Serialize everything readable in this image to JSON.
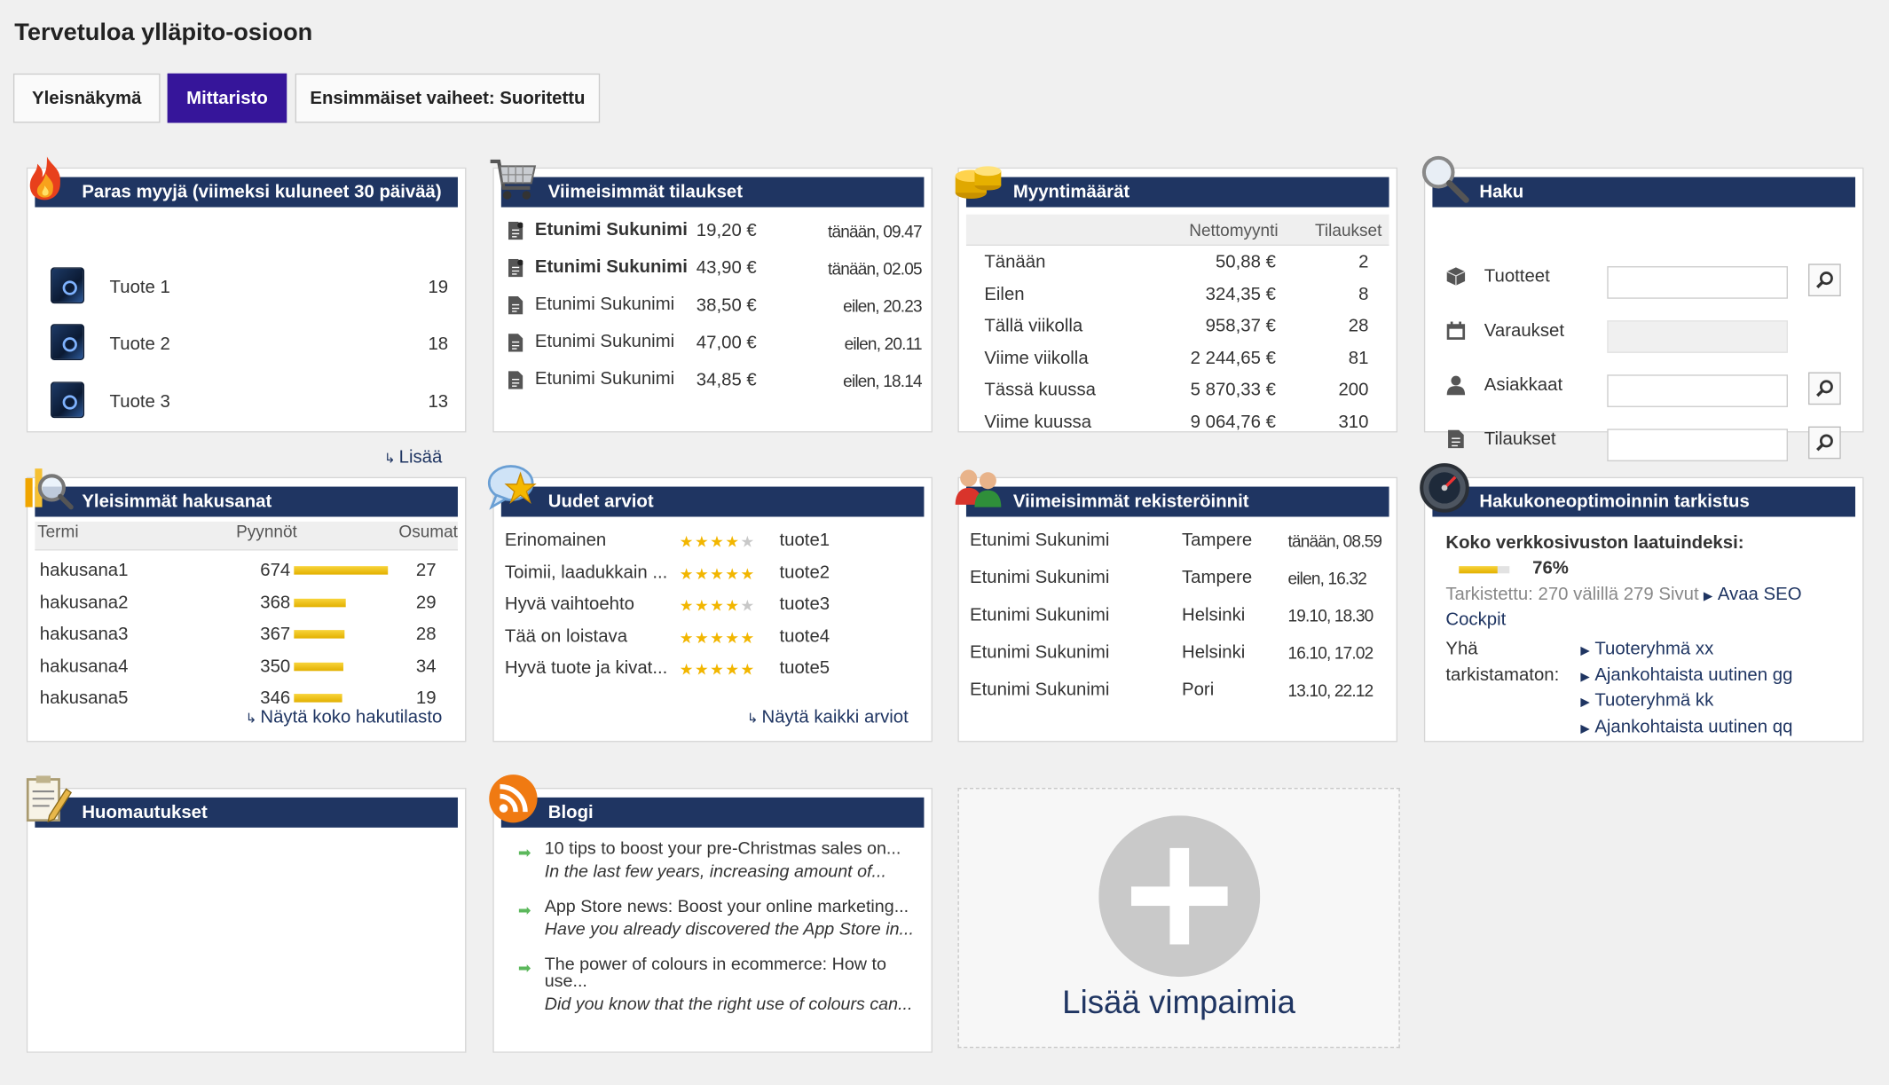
{
  "page": {
    "title": "Tervetuloa ylläpito-osioon"
  },
  "tabs": [
    {
      "label": "Yleisnäkymä"
    },
    {
      "label": "Mittaristo"
    },
    {
      "label": "Ensimmäiset vaiheet: Suoritettu"
    }
  ],
  "best_seller": {
    "title": "Paras myyjä (viimeksi kuluneet 30 päivää)",
    "items": [
      {
        "name": "Tuote 1",
        "count": "19"
      },
      {
        "name": "Tuote 2",
        "count": "18"
      },
      {
        "name": "Tuote 3",
        "count": "13"
      }
    ],
    "more_link": "Lisää"
  },
  "recent_orders": {
    "title": "Viimeisimmät tilaukset",
    "rows": [
      {
        "name": "Etunimi Sukunimi",
        "amount": "19,20 €",
        "time": "tänään, 09.47",
        "bold": true
      },
      {
        "name": "Etunimi Sukunimi",
        "amount": "43,90 €",
        "time": "tänään, 02.05",
        "bold": true
      },
      {
        "name": "Etunimi Sukunimi",
        "amount": "38,50 €",
        "time": "eilen, 20.23",
        "bold": false
      },
      {
        "name": "Etunimi Sukunimi",
        "amount": "47,00 €",
        "time": "eilen, 20.11",
        "bold": false
      },
      {
        "name": "Etunimi Sukunimi",
        "amount": "34,85 €",
        "time": "eilen, 18.14",
        "bold": false
      }
    ]
  },
  "sales": {
    "title": "Myyntimäärät",
    "col_net": "Nettomyynti",
    "col_orders": "Tilaukset",
    "rows": [
      {
        "period": "Tänään",
        "net": "50,88 €",
        "orders": "2"
      },
      {
        "period": "Eilen",
        "net": "324,35 €",
        "orders": "8"
      },
      {
        "period": "Tällä viikolla",
        "net": "958,37 €",
        "orders": "28"
      },
      {
        "period": "Viime viikolla",
        "net": "2 244,65 €",
        "orders": "81"
      },
      {
        "period": "Tässä kuussa",
        "net": "5 870,33 €",
        "orders": "200"
      },
      {
        "period": "Viime kuussa",
        "net": "9 064,76 €",
        "orders": "310"
      }
    ]
  },
  "search": {
    "title": "Haku",
    "rows": [
      {
        "label": "Tuotteet",
        "icon": "box-icon",
        "enabled": true
      },
      {
        "label": "Varaukset",
        "icon": "calendar-icon",
        "enabled": false
      },
      {
        "label": "Asiakkaat",
        "icon": "person-icon",
        "enabled": true
      },
      {
        "label": "Tilaukset",
        "icon": "document-icon",
        "enabled": true
      }
    ]
  },
  "keywords": {
    "title": "Yleisimmät hakusanat",
    "col_term": "Termi",
    "col_requests": "Pyynnöt",
    "col_hits": "Osumat",
    "rows": [
      {
        "term": "hakusana1",
        "requests": 674,
        "hits": "27"
      },
      {
        "term": "hakusana2",
        "requests": 368,
        "hits": "29"
      },
      {
        "term": "hakusana3",
        "requests": 367,
        "hits": "28"
      },
      {
        "term": "hakusana4",
        "requests": 350,
        "hits": "34"
      },
      {
        "term": "hakusana5",
        "requests": 346,
        "hits": "19"
      }
    ],
    "link": "Näytä koko hakutilasto"
  },
  "reviews": {
    "title": "Uudet arviot",
    "rows": [
      {
        "text": "Erinomainen",
        "stars": 4,
        "product": "tuote1"
      },
      {
        "text": "Toimii, laadukkain ...",
        "stars": 5,
        "product": "tuote2"
      },
      {
        "text": "Hyvä vaihtoehto",
        "stars": 4,
        "product": "tuote3"
      },
      {
        "text": "Tää on loistava",
        "stars": 5,
        "product": "tuote4"
      },
      {
        "text": "Hyvä tuote ja kivat...",
        "stars": 5,
        "product": "tuote5"
      }
    ],
    "link": "Näytä kaikki arviot"
  },
  "registrations": {
    "title": "Viimeisimmät rekisteröinnit",
    "rows": [
      {
        "name": "Etunimi Sukunimi",
        "city": "Tampere",
        "time": "tänään, 08.59"
      },
      {
        "name": "Etunimi Sukunimi",
        "city": "Tampere",
        "time": "eilen, 16.32"
      },
      {
        "name": "Etunimi Sukunimi",
        "city": "Helsinki",
        "time": "19.10, 18.30"
      },
      {
        "name": "Etunimi Sukunimi",
        "city": "Helsinki",
        "time": "16.10, 17.02"
      },
      {
        "name": "Etunimi Sukunimi",
        "city": "Pori",
        "time": "13.10, 22.12"
      }
    ]
  },
  "seo": {
    "title": "Hakukoneoptimoinnin tarkistus",
    "quality_label": "Koko verkkosivuston laatuindeksi:",
    "quality_value": "76%",
    "quality_fraction": 0.76,
    "checked_text": "Tarkistettu: 270 välillä 279 Sivut",
    "cockpit_link_line1": "Avaa SEO",
    "cockpit_link_line2": "Cockpit",
    "unchecked_label_line1": "Yhä",
    "unchecked_label_line2": "tarkistamaton:",
    "unchecked_items": [
      "Tuoteryhmä xx",
      "Ajankohtaista uutinen gg",
      "Tuoteryhmä kk",
      "Ajankohtaista uutinen qq"
    ]
  },
  "notes": {
    "title": "Huomautukset"
  },
  "blog": {
    "title": "Blogi",
    "posts": [
      {
        "title": "10 tips to boost your pre-Christmas sales on...",
        "excerpt": "In the last few years, increasing amount of..."
      },
      {
        "title": "App Store news: Boost your online marketing...",
        "excerpt": "Have you already discovered the App Store in..."
      },
      {
        "title": "The power of colours in ecommerce: How to",
        "title2": "use...",
        "excerpt": "Did you know that the right use of colours can..."
      }
    ]
  },
  "add_widget": {
    "label": "Lisää vimpaimia"
  },
  "colors": {
    "header": "#1f3562",
    "active_tab": "#36159a",
    "bar": "#f2c21b",
    "star": "#f2b600",
    "blog_arrow": "#5cb85c"
  }
}
